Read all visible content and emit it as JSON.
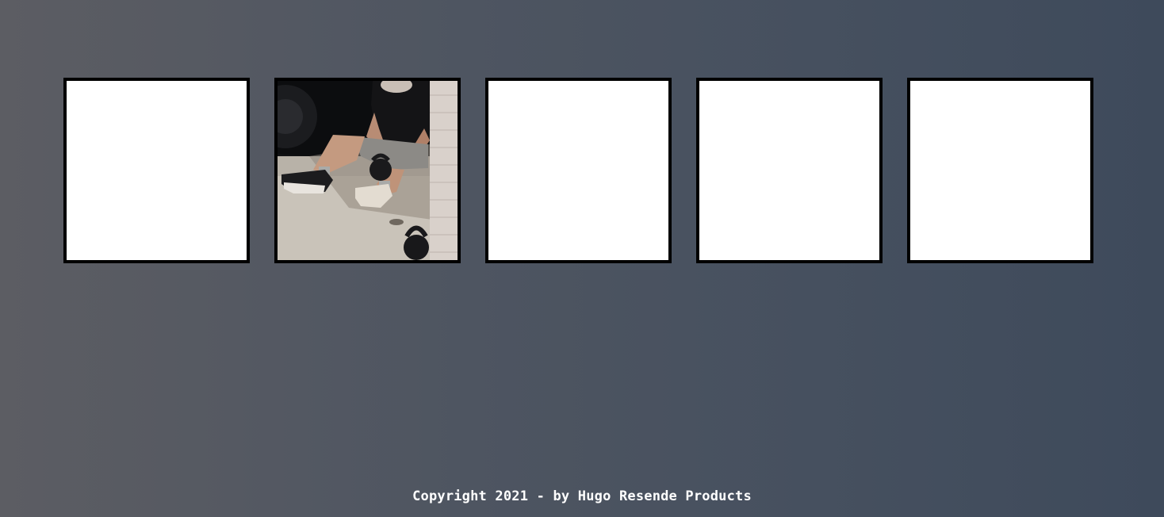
{
  "cards": [
    {
      "state": "face-down",
      "image": ""
    },
    {
      "state": "revealed",
      "image": "man-with-kettlebells-photo"
    },
    {
      "state": "face-down",
      "image": ""
    },
    {
      "state": "face-down",
      "image": ""
    },
    {
      "state": "face-down",
      "image": ""
    }
  ],
  "footer": {
    "text": "Copyright 2021 - by Hugo Resende Products"
  },
  "colors": {
    "card_border": "#000000",
    "card_face": "#ffffff",
    "background_left": "#5c5d63",
    "background_right": "#3e4a5b",
    "footer_text": "#ffffff"
  }
}
